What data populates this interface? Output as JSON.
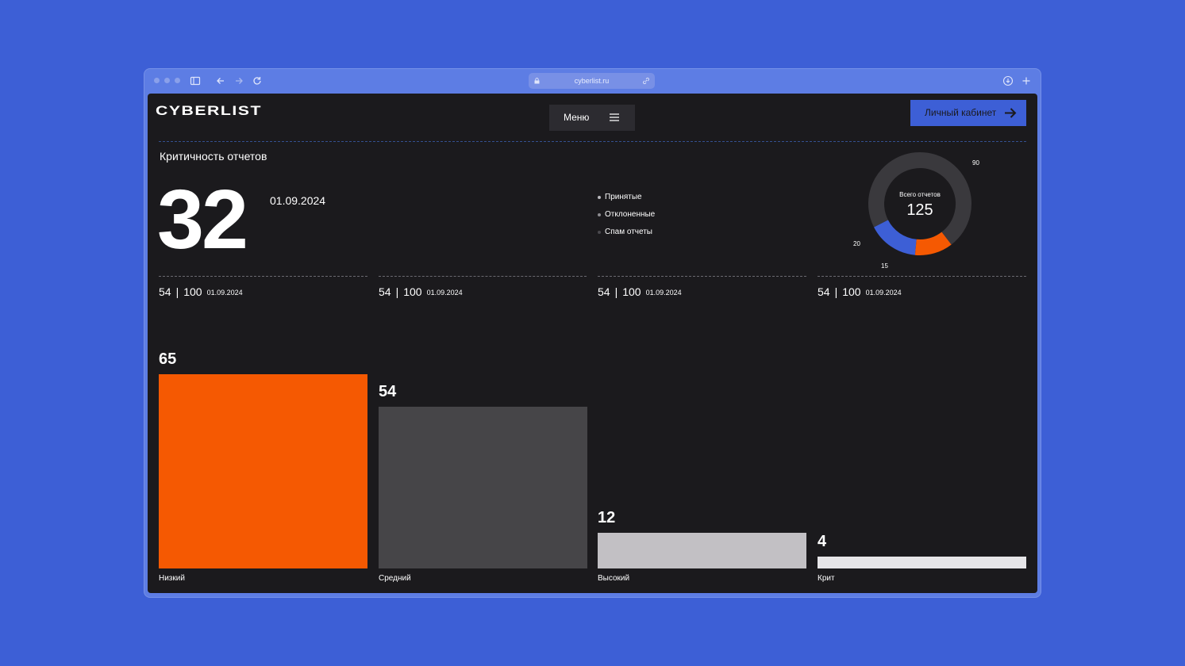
{
  "browser": {
    "url": "cyberlist.ru"
  },
  "header": {
    "logo": "CYBERLIST",
    "menu_label": "Меню",
    "cabinet_label": "Личный кабинет"
  },
  "report": {
    "title": "Критичность отчетов",
    "count": "32",
    "date": "01.09.2024"
  },
  "legend": [
    {
      "label": "Принятые",
      "color": "#b9b8bd"
    },
    {
      "label": "Отклоненные",
      "color": "#8d8c91"
    },
    {
      "label": "Спам отчеты",
      "color": "#4a494e"
    }
  ],
  "donut": {
    "center_label": "Всего отчетов",
    "total": "125",
    "labels": [
      "90",
      "20",
      "15"
    ],
    "segments": [
      {
        "value": 90,
        "color": "#3a393d"
      },
      {
        "value": 15,
        "color": "#f55902"
      },
      {
        "value": 20,
        "color": "#3d5fd6"
      }
    ]
  },
  "stats": [
    {
      "a": "54",
      "sep": "|",
      "b": "100",
      "date": "01.09.2024"
    },
    {
      "a": "54",
      "sep": "|",
      "b": "100",
      "date": "01.09.2024"
    },
    {
      "a": "54",
      "sep": "|",
      "b": "100",
      "date": "01.09.2024"
    },
    {
      "a": "54",
      "sep": "|",
      "b": "100",
      "date": "01.09.2024"
    }
  ],
  "chart_data": {
    "type": "bar",
    "categories": [
      "Низкий",
      "Средний",
      "Высокий",
      "Крит"
    ],
    "values": [
      65,
      54,
      12,
      4
    ],
    "value_labels": [
      "65",
      "54",
      "12",
      "4"
    ],
    "colors": [
      "#f55902",
      "#464548",
      "#c2c0c4",
      "#e6e5e8"
    ],
    "title": "",
    "xlabel": "",
    "ylabel": ""
  },
  "colors": {
    "accent": "#3d5fd6",
    "orange": "#f55902",
    "background": "#1b1a1d"
  }
}
